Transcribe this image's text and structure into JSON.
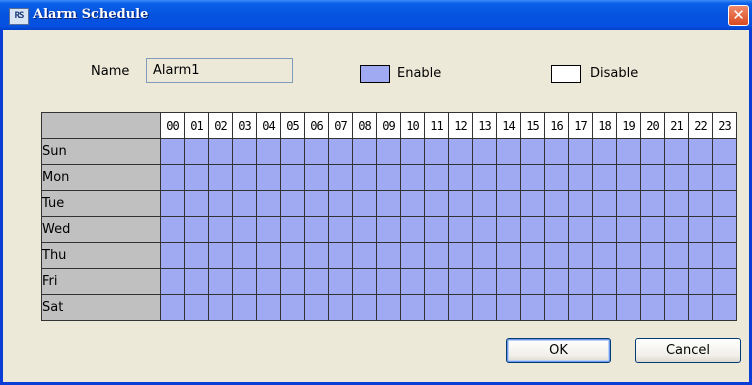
{
  "window": {
    "title": "Alarm Schedule",
    "app_icon_text": "RS",
    "close_glyph": "✕",
    "title_bar_color": "#0453de"
  },
  "form": {
    "name_label": "Name",
    "name_value": "Alarm1"
  },
  "legend": {
    "enable_label": "Enable",
    "enable_color": "#a0aaf2",
    "disable_label": "Disable",
    "disable_color": "#ffffff"
  },
  "schedule": {
    "hours": [
      "00",
      "01",
      "02",
      "03",
      "04",
      "05",
      "06",
      "07",
      "08",
      "09",
      "10",
      "11",
      "12",
      "13",
      "14",
      "15",
      "16",
      "17",
      "18",
      "19",
      "20",
      "21",
      "22",
      "23"
    ],
    "days": [
      "Sun",
      "Mon",
      "Tue",
      "Wed",
      "Thu",
      "Fri",
      "Sat"
    ],
    "all_enabled": true
  },
  "buttons": {
    "ok": "OK",
    "cancel": "Cancel"
  }
}
